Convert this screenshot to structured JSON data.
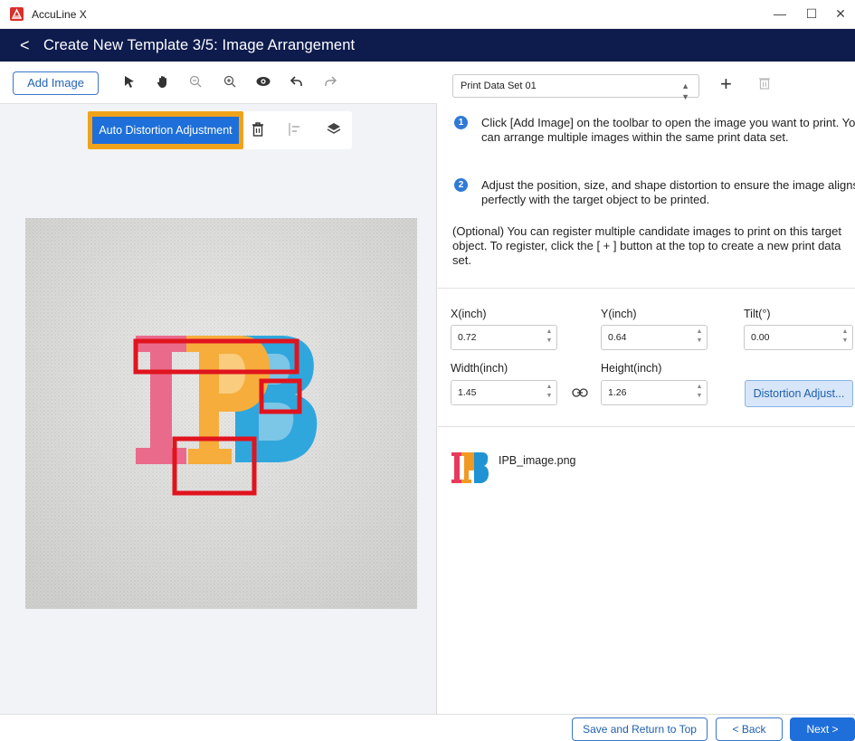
{
  "window": {
    "app_title": "AccuLine X",
    "minimize": "—",
    "maximize": "☐",
    "close": "✕"
  },
  "header": {
    "back": "<",
    "title": "Create New Template 3/5: Image Arrangement"
  },
  "toolbar": {
    "add_image": "Add Image",
    "icons": [
      "select-arrow-icon",
      "hand-pan-icon",
      "zoom-out-icon",
      "zoom-in-icon",
      "eye-preview-icon",
      "undo-icon",
      "redo-icon"
    ]
  },
  "floating_toolbar": {
    "auto_distortion": "Auto Distortion Adjustment",
    "highlight_color": "#f0a31a"
  },
  "canvas": {
    "logo_letters": "IPB",
    "annotation_color": "#e0141e"
  },
  "right": {
    "dataset_select": "Print Data Set 01",
    "steps": [
      {
        "num": "1",
        "text": "Click [Add Image] on the toolbar to open the image you want to print. You can arrange multiple images within the same print data set."
      },
      {
        "num": "2",
        "text": "Adjust the position, size, and shape distortion to ensure the image aligns perfectly with the target object to be printed."
      }
    ],
    "optional": "(Optional) You can register multiple candidate images to print on this target object. To register, click the [ + ] button at the top to create a new print data set.",
    "fields": {
      "x_label": "X(inch)",
      "x_value": "0.72",
      "y_label": "Y(inch)",
      "y_value": "0.64",
      "tilt_label": "Tilt(°)",
      "tilt_value": "0.00",
      "width_label": "Width(inch)",
      "width_value": "1.45",
      "height_label": "Height(inch)",
      "height_value": "1.26"
    },
    "distortion_button": "Distortion Adjust...",
    "file_name": "IPB_image.png"
  },
  "footer": {
    "save": "Save and Return to Top",
    "back": "< Back",
    "next": "Next >"
  },
  "colors": {
    "header_bg": "#0d1b4d",
    "accent": "#1e6fd9"
  }
}
